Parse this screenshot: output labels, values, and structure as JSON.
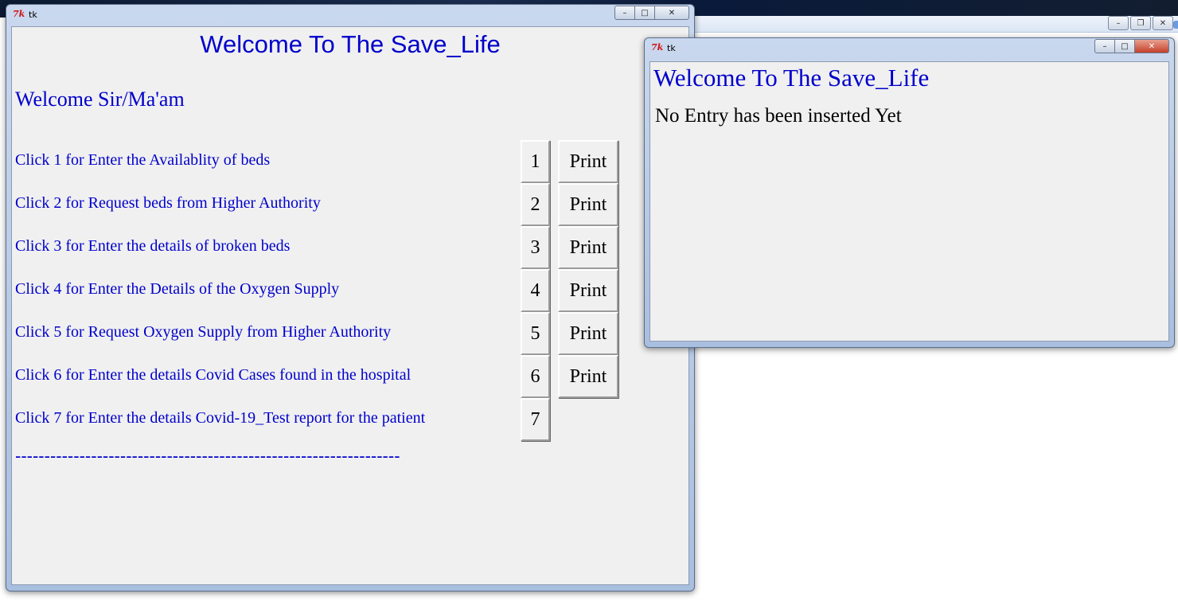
{
  "desktop": {
    "bg_controls": [
      "–",
      "❐",
      "✕"
    ]
  },
  "main_window": {
    "title": "tk",
    "controls": {
      "minimize": "–",
      "maximize": "□",
      "close": "✕"
    },
    "heading": "Welcome To The Save_Life",
    "greeting": "Welcome Sir/Ma'am",
    "options": [
      {
        "label": "Click 1 for Enter the Availablity of beds",
        "button": "1",
        "print": "Print"
      },
      {
        "label": "Click 2 for Request beds from Higher Authority",
        "button": "2",
        "print": "Print"
      },
      {
        "label": "Click 3 for Enter the details of broken beds",
        "button": "3",
        "print": "Print"
      },
      {
        "label": "Click 4 for Enter the Details of the Oxygen Supply",
        "button": "4",
        "print": "Print"
      },
      {
        "label": "Click 5 for Request Oxygen Supply from Higher Authority",
        "button": "5",
        "print": "Print"
      },
      {
        "label": "Click 6 for Enter the details Covid Cases found in the hospital",
        "button": "6",
        "print": "Print"
      },
      {
        "label": "Click 7 for Enter the details Covid-19_Test report for the patient",
        "button": "7"
      }
    ],
    "divider": "------------------------------------------------------------------"
  },
  "popup_window": {
    "title": "tk",
    "controls": {
      "minimize": "–",
      "maximize": "□",
      "close": "✕"
    },
    "heading": "Welcome To The Save_Life",
    "message": "No Entry has been inserted Yet"
  },
  "colors": {
    "heading_blue": "#0000cc",
    "client_bg": "#f0f0f0",
    "text_black": "#000000"
  },
  "icons": {
    "tk_icon": "tk-feather-icon"
  }
}
